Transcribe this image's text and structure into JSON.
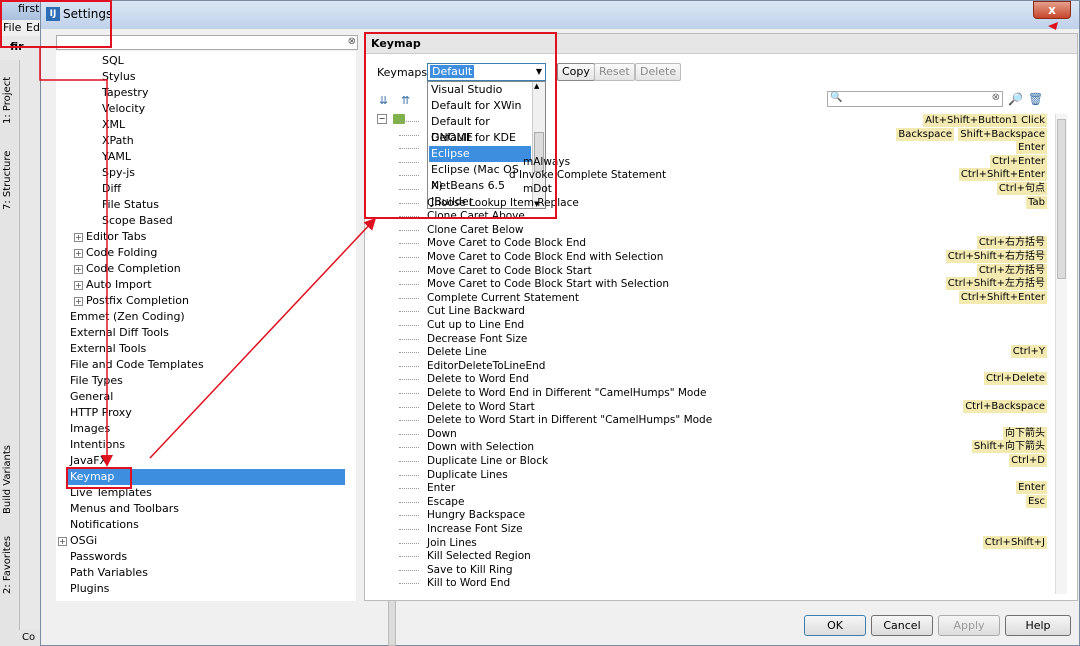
{
  "ide": {
    "title": "first",
    "menu": [
      "File",
      "Ed"
    ],
    "project_tab": "fir",
    "side_tabs": [
      "1: Project",
      "7: Structure",
      "Build Variants",
      "2: Favorites"
    ],
    "bottom_label": "Co"
  },
  "dialog": {
    "title": "Settings",
    "close_label": "x",
    "buttons": {
      "ok": "OK",
      "cancel": "Cancel",
      "apply": "Apply",
      "help": "Help"
    }
  },
  "tree": {
    "sub_items": [
      "SQL",
      "Stylus",
      "Tapestry",
      "Velocity",
      "XML",
      "XPath",
      "YAML",
      "Spy-js",
      "Diff",
      "File Status",
      "Scope Based"
    ],
    "expandable_items": [
      "Editor Tabs",
      "Code Folding",
      "Code Completion",
      "Auto Import",
      "Postfix Completion"
    ],
    "top_items": [
      "Emmet (Zen Coding)",
      "External Diff Tools",
      "External Tools",
      "File and Code Templates",
      "File Types",
      "General",
      "HTTP Proxy",
      "Images",
      "Intentions",
      "JavaFX",
      "Keymap",
      "Live Templates",
      "Menus and Toolbars",
      "Notifications",
      "OSGi",
      "Passwords",
      "Path Variables",
      "Plugins"
    ],
    "selected": "Keymap"
  },
  "keymap": {
    "header": "Keymap",
    "label": "Keymaps:",
    "selected": "Default",
    "buttons": {
      "copy": "Copy",
      "reset": "Reset",
      "delete": "Delete"
    },
    "options": [
      "Visual Studio",
      "Default for XWin",
      "Default for GNOME",
      "Default for KDE",
      "Eclipse",
      "Eclipse (Mac OS X)",
      "NetBeans 6.5",
      "JBuilder"
    ],
    "highlighted_option": "Eclipse"
  },
  "actions": [
    {
      "name": "",
      "shortcuts": [
        "Alt+Shift+Button1 Click"
      ]
    },
    {
      "name": "",
      "shortcuts": [
        "Backspace",
        "Shift+Backspace"
      ]
    },
    {
      "name": "",
      "shortcuts": [
        "Enter"
      ]
    },
    {
      "name": "mAlways",
      "shortcuts": [
        "Ctrl+Enter"
      ]
    },
    {
      "name": "d Invoke Complete Statement",
      "shortcuts": [
        "Ctrl+Shift+Enter"
      ]
    },
    {
      "name": "mDot",
      "shortcuts": [
        "Ctrl+句点"
      ]
    },
    {
      "name": "Choose Lookup Item Replace",
      "shortcuts": [
        "Tab"
      ]
    },
    {
      "name": "Clone Caret Above",
      "shortcuts": []
    },
    {
      "name": "Clone Caret Below",
      "shortcuts": []
    },
    {
      "name": "Move Caret to Code Block End",
      "shortcuts": [
        "Ctrl+右方括号"
      ]
    },
    {
      "name": "Move Caret to Code Block End with Selection",
      "shortcuts": [
        "Ctrl+Shift+右方括号"
      ]
    },
    {
      "name": "Move Caret to Code Block Start",
      "shortcuts": [
        "Ctrl+左方括号"
      ]
    },
    {
      "name": "Move Caret to Code Block Start with Selection",
      "shortcuts": [
        "Ctrl+Shift+左方括号"
      ]
    },
    {
      "name": "Complete Current Statement",
      "shortcuts": [
        "Ctrl+Shift+Enter"
      ]
    },
    {
      "name": "Cut Line Backward",
      "shortcuts": []
    },
    {
      "name": "Cut up to Line End",
      "shortcuts": []
    },
    {
      "name": "Decrease Font Size",
      "shortcuts": []
    },
    {
      "name": "Delete Line",
      "shortcuts": [
        "Ctrl+Y"
      ]
    },
    {
      "name": "EditorDeleteToLineEnd",
      "shortcuts": []
    },
    {
      "name": "Delete to Word End",
      "shortcuts": [
        "Ctrl+Delete"
      ]
    },
    {
      "name": "Delete to Word End in Different \"CamelHumps\" Mode",
      "shortcuts": []
    },
    {
      "name": "Delete to Word Start",
      "shortcuts": [
        "Ctrl+Backspace"
      ]
    },
    {
      "name": "Delete to Word Start in Different \"CamelHumps\" Mode",
      "shortcuts": []
    },
    {
      "name": "Down",
      "shortcuts": [
        "向下箭头"
      ]
    },
    {
      "name": "Down with Selection",
      "shortcuts": [
        "Shift+向下箭头"
      ]
    },
    {
      "name": "Duplicate Line or Block",
      "shortcuts": [
        "Ctrl+D"
      ]
    },
    {
      "name": "Duplicate Lines",
      "shortcuts": []
    },
    {
      "name": "Enter",
      "shortcuts": [
        "Enter"
      ]
    },
    {
      "name": "Escape",
      "shortcuts": [
        "Esc"
      ]
    },
    {
      "name": "Hungry Backspace",
      "shortcuts": []
    },
    {
      "name": "Increase Font Size",
      "shortcuts": []
    },
    {
      "name": "Join Lines",
      "shortcuts": [
        "Ctrl+Shift+J"
      ]
    },
    {
      "name": "Kill Selected Region",
      "shortcuts": []
    },
    {
      "name": "Save to Kill Ring",
      "shortcuts": []
    },
    {
      "name": "Kill to Word End",
      "shortcuts": []
    }
  ],
  "colors": {
    "annotation": "#e01020",
    "selection": "#3e8ee0",
    "shortcut_bg": "#f3eab2"
  }
}
